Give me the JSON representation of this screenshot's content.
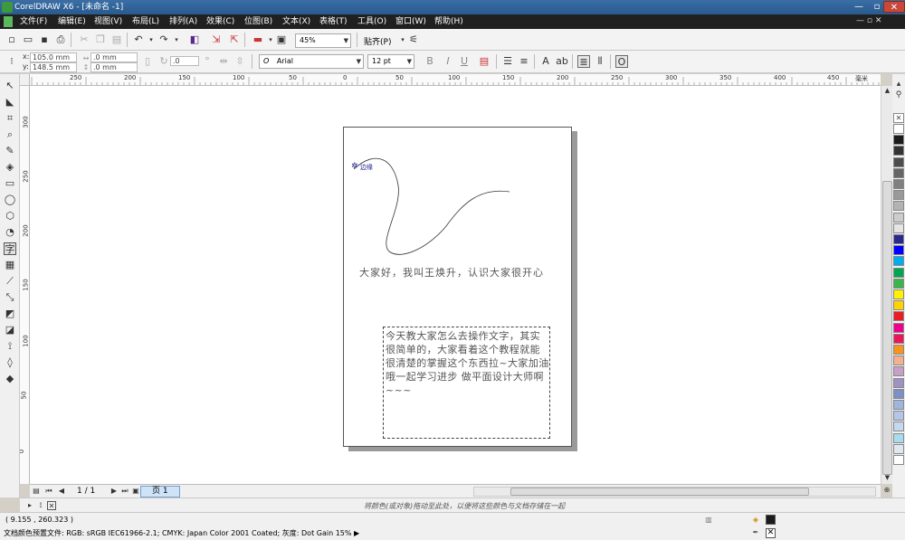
{
  "window": {
    "title": "CorelDRAW X6 - [未命名 -1]",
    "min_glyph": "—",
    "max_glyph": "▫",
    "close_glyph": "✕"
  },
  "menus": [
    "文件(F)",
    "编辑(E)",
    "视图(V)",
    "布局(L)",
    "排列(A)",
    "效果(C)",
    "位图(B)",
    "文本(X)",
    "表格(T)",
    "工具(O)",
    "窗口(W)",
    "帮助(H)"
  ],
  "menu_sys_buttons": "— ▫ ✕",
  "toolbar1": {
    "zoom_value": "45%",
    "snap_label": "贴齐(P)"
  },
  "toolbar2": {
    "x_label": "x:",
    "x_value": "105.0 mm",
    "y_label": "y:",
    "y_value": "148.5 mm",
    "w_value": ".0 mm",
    "h_value": ".0 mm",
    "angle_value": ".0",
    "font_name": "Arial",
    "font_size": "12 pt",
    "font_style_bold": "B",
    "font_style_italic": "I",
    "font_style_underline": "U"
  },
  "ruler": {
    "top_labels": [
      "250",
      "200",
      "150",
      "100",
      "50",
      "0",
      "50",
      "100",
      "150",
      "200",
      "250",
      "300",
      "350",
      "400",
      "450"
    ],
    "unit": "毫米",
    "left_labels": [
      "300",
      "250",
      "200",
      "150",
      "100",
      "50",
      "0"
    ]
  },
  "canvas": {
    "path_label": "边缘",
    "artistic_text": "大家好，我叫王焕升，认识大家很开心",
    "paragraph_text": "今天教大家怎么去操作文字，其实很简单的，大家看着这个教程就能很清楚的掌握这个东西拉~大家加油哦一起学习进步 做平面设计大师啊~~~"
  },
  "pagebar": {
    "counter": "1 / 1",
    "page_tab": "页 1"
  },
  "doc_palette_hint": "将颜色(或对象)拖动至此处，以便将这些颜色与文档存储在一起",
  "status": {
    "coords": "( 9.155 , 260.323 )",
    "profile": "文档颜色预置文件: RGB: sRGB IEC61966-2.1; CMYK: Japan Color 2001 Coated; 灰度: Dot Gain 15%",
    "profile_arrow": "▶"
  },
  "palette_colors": [
    "#ffffff",
    "#1a1a1a",
    "#333333",
    "#4d4d4d",
    "#666666",
    "#808080",
    "#999999",
    "#b3b3b3",
    "#cccccc",
    "#e5e5e5",
    "#2a2a8c",
    "#0000ff",
    "#00aeef",
    "#00a651",
    "#39b54a",
    "#fff200",
    "#ffd200",
    "#ed1c24",
    "#ec008c",
    "#ed145b",
    "#f7941d",
    "#f5b08f",
    "#c7a0c8",
    "#9e91c4",
    "#7c8fc6",
    "#9fb5dd",
    "#b3c6e8",
    "#c6d8ef",
    "#a8dced",
    "#e0e7f0",
    "#ffffff"
  ]
}
